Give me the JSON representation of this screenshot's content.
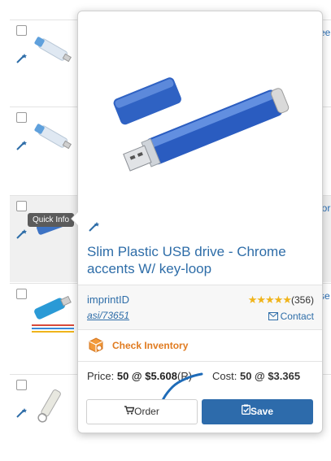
{
  "list": {
    "tooltip": "Quick Info",
    "rows": [
      {
        "edge_text": "ee"
      },
      {
        "edge_text": ""
      },
      {
        "edge_text": "ior"
      },
      {
        "edge_text": "se"
      },
      {
        "edge_text": ""
      }
    ]
  },
  "popup": {
    "title": "Slim Plastic USB drive - Chrome accents W/ key-loop",
    "supplier": "imprintID",
    "asi": "asi/73651",
    "rating_stars": "★★★★★",
    "rating_count": "(356)",
    "contact": "Contact",
    "check_inventory": "Check Inventory",
    "price_label": "Price:",
    "price_value": "50 @ $5.608",
    "price_suffix": "(R)",
    "cost_label": "Cost:",
    "cost_value": "50 @ $3.365",
    "order_label": "Order",
    "save_label": "Save"
  },
  "colors": {
    "link": "#2e6da8",
    "accent_orange": "#e07b20",
    "save_button": "#2d6bab",
    "star": "#f0b41b"
  },
  "icons": [
    "magic-wand-icon",
    "envelope-icon",
    "cart-icon",
    "clipboard-check-icon",
    "inventory-box-icon"
  ]
}
